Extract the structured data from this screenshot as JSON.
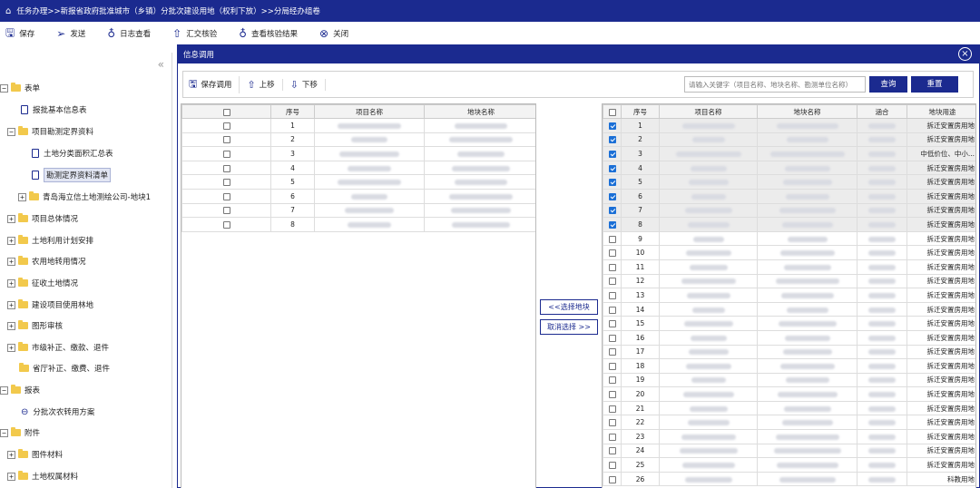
{
  "title_bar": {
    "breadcrumb": "任务办理>>新报省政府批准城市（乡镇）分批次建设用地（权利下放）>>分局经办组卷"
  },
  "toolbar": {
    "save": "保存",
    "send": "发送",
    "log": "日志查看",
    "submit_check": "汇交核验",
    "view_check": "查看核验结果",
    "close": "关闭"
  },
  "tree": {
    "collapse": "«",
    "items": [
      {
        "label": "表单"
      },
      {
        "label": "报批基本信息表"
      },
      {
        "label": "项目勘测定界资料"
      },
      {
        "label": "土地分类面积汇总表"
      },
      {
        "label": "勘测定界资料清单"
      },
      {
        "label": "青岛海立信土地测绘公司-地块1"
      },
      {
        "label": "项目总体情况"
      },
      {
        "label": "土地利用计划安排"
      },
      {
        "label": "农用地转用情况"
      },
      {
        "label": "征收土地情况"
      },
      {
        "label": "建设项目使用林地"
      },
      {
        "label": "图形审核"
      },
      {
        "label": "市级补正、缴款、退件"
      },
      {
        "label": "省厅补正、缴费、退件"
      },
      {
        "label": "报表"
      },
      {
        "label": "分批次农转用方案"
      },
      {
        "label": "附件"
      },
      {
        "label": "图件材料"
      },
      {
        "label": "土地权属材料"
      }
    ]
  },
  "modal": {
    "title": "信息调用",
    "close_icon": "⊗",
    "toolbar": {
      "save_call": "保存调用",
      "move_up": "上移",
      "move_down": "下移"
    },
    "search_placeholder": "请输入关键字（项目名称、地块名称、勘测单位名称）",
    "query": "查询",
    "reset": "重置",
    "select_btn": "<<选择地块",
    "cancel_btn": "取消选择 >>",
    "left_table": {
      "headers": [
        "序号",
        "项目名称",
        "地块名称"
      ],
      "rows": [
        "1",
        "2",
        "3",
        "4",
        "5",
        "6",
        "7",
        "8"
      ]
    },
    "right_table": {
      "headers": [
        "序号",
        "项目名称",
        "地块名称",
        "涵合",
        "地块用途"
      ],
      "rows": [
        {
          "no": "1",
          "use": "拆迁安置房用地",
          "checked": true
        },
        {
          "no": "2",
          "use": "拆迁安置房用地",
          "checked": true
        },
        {
          "no": "3",
          "use": "中低价位、中小...",
          "checked": true
        },
        {
          "no": "4",
          "use": "拆迁安置房用地",
          "checked": true
        },
        {
          "no": "5",
          "use": "拆迁安置房用地",
          "checked": true
        },
        {
          "no": "6",
          "use": "拆迁安置房用地",
          "checked": true
        },
        {
          "no": "7",
          "use": "拆迁安置房用地",
          "checked": true
        },
        {
          "no": "8",
          "use": "拆迁安置房用地",
          "checked": true
        },
        {
          "no": "9",
          "use": "拆迁安置房用地",
          "checked": false
        },
        {
          "no": "10",
          "use": "拆迁安置房用地",
          "checked": false
        },
        {
          "no": "11",
          "use": "拆迁安置房用地",
          "checked": false
        },
        {
          "no": "12",
          "use": "拆迁安置房用地",
          "checked": false
        },
        {
          "no": "13",
          "use": "拆迁安置房用地",
          "checked": false
        },
        {
          "no": "14",
          "use": "拆迁安置房用地",
          "checked": false
        },
        {
          "no": "15",
          "use": "拆迁安置房用地",
          "checked": false
        },
        {
          "no": "16",
          "use": "拆迁安置房用地",
          "checked": false
        },
        {
          "no": "17",
          "use": "拆迁安置房用地",
          "checked": false
        },
        {
          "no": "18",
          "use": "拆迁安置房用地",
          "checked": false
        },
        {
          "no": "19",
          "use": "拆迁安置房用地",
          "checked": false
        },
        {
          "no": "20",
          "use": "拆迁安置房用地",
          "checked": false
        },
        {
          "no": "21",
          "use": "拆迁安置房用地",
          "checked": false
        },
        {
          "no": "22",
          "use": "拆迁安置房用地",
          "checked": false
        },
        {
          "no": "23",
          "use": "拆迁安置房用地",
          "checked": false
        },
        {
          "no": "24",
          "use": "拆迁安置房用地",
          "checked": false
        },
        {
          "no": "25",
          "use": "拆迁安置房用地",
          "checked": false
        },
        {
          "no": "26",
          "use": "科教用地",
          "checked": false
        }
      ]
    }
  }
}
